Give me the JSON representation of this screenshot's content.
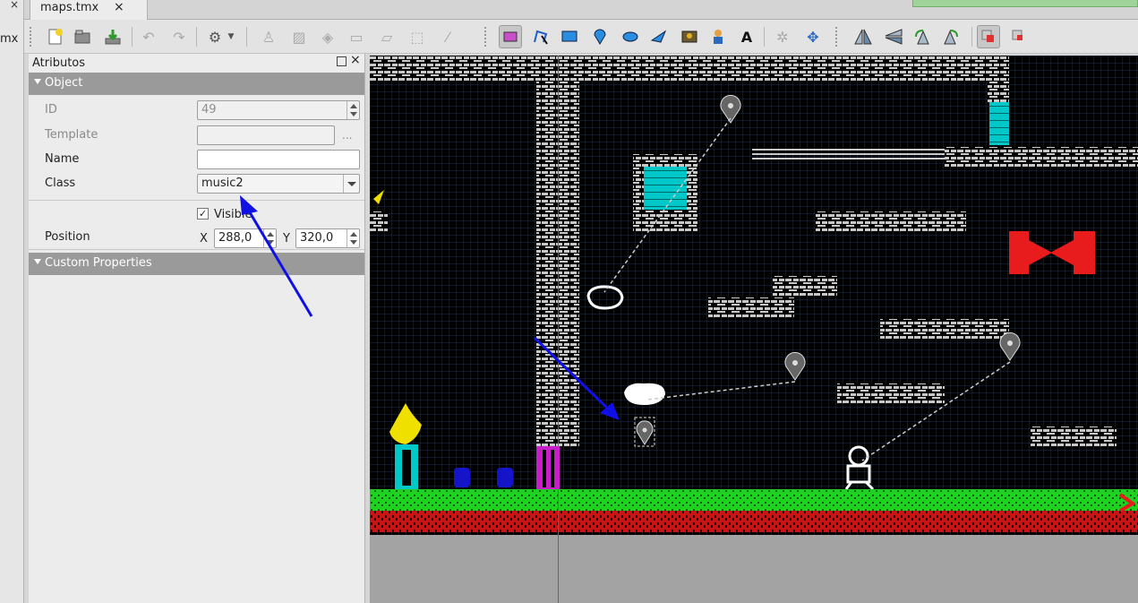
{
  "left_strip": {
    "close_glyph": "×",
    "label": "mx"
  },
  "tabs": {
    "active_label": "maps.tmx",
    "close_glyph": "×"
  },
  "toolbar": {
    "icons": [
      "new-map-icon",
      "open-icon",
      "save-icon",
      "undo-icon",
      "redo-icon",
      "commands-icon",
      "stamp-brush-icon",
      "terrain-brush-icon",
      "bucket-fill-icon",
      "shape-fill-icon",
      "eraser-icon",
      "rectangle-select-icon",
      "magic-wand-icon",
      "select-objects-icon",
      "edit-polygons-icon",
      "insert-rectangle-icon",
      "insert-point-icon",
      "insert-ellipse-icon",
      "insert-polygon-icon",
      "insert-tile-icon",
      "insert-template-icon",
      "insert-text-icon",
      "random-mode-icon",
      "wang-fill-icon",
      "flip-horizontal-icon",
      "flip-vertical-icon",
      "rotate-left-icon",
      "rotate-right-icon",
      "highlight-layer-icon",
      "show-hovered-icon"
    ]
  },
  "panel": {
    "title": "Atributos",
    "float_icon": "float-icon",
    "close_glyph": "×",
    "object_section": "Object",
    "custom_section": "Custom Properties",
    "id_label": "ID",
    "id_value": "49",
    "template_label": "Template",
    "template_value": "",
    "template_button": "...",
    "name_label": "Name",
    "name_value": "",
    "class_label": "Class",
    "class_value": "music2",
    "visible_check": "✓",
    "visible_label": "Visible",
    "position_label": "Position",
    "x_label": "X",
    "x_value": "288,0",
    "y_label": "Y",
    "y_value": "320,0"
  },
  "colors": {
    "map_bg": "#000000",
    "grid": "#123a6a",
    "brick": "#c8c8c8",
    "cyan": "#00c8c8",
    "grass": "#1fd21f",
    "dirt": "#c81414",
    "annotation_arrow": "#1010e6",
    "flag_red": "#e81c1c",
    "flame": "#f0e000",
    "pillar_magenta": "#c81ec8",
    "blue_block": "#1414c8"
  }
}
